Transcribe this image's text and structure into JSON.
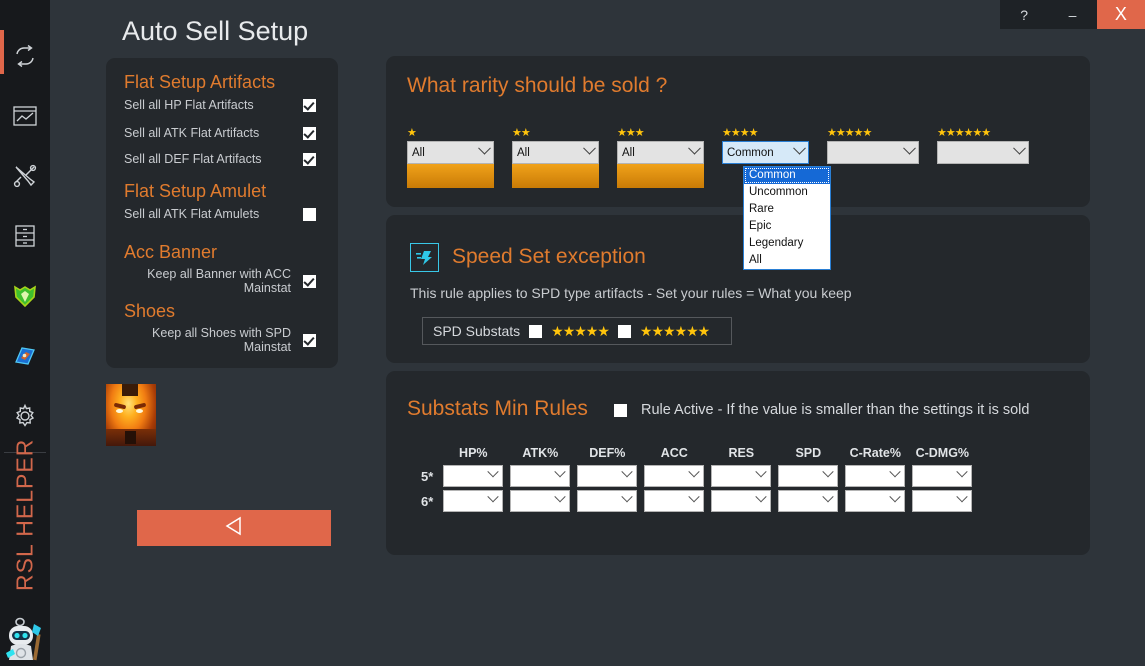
{
  "window": {
    "help_label": "?",
    "minimize_label": "–",
    "close_label": "X"
  },
  "page_title": "Auto Sell Setup",
  "sidebar": {
    "brand": "RSL HELPER",
    "items": [
      {
        "name": "sync-icon",
        "active": true
      },
      {
        "name": "chart-icon",
        "active": false
      },
      {
        "name": "tools-icon",
        "active": false
      },
      {
        "name": "storage-icon",
        "active": false
      },
      {
        "name": "shield-icon",
        "active": false
      },
      {
        "name": "gem-icon",
        "active": false
      },
      {
        "name": "gear-icon",
        "active": false
      }
    ]
  },
  "left_panel": {
    "sections": [
      {
        "title": "Flat Setup Artifacts",
        "rows": [
          {
            "label": "Sell all HP Flat Artifacts",
            "checked": true
          },
          {
            "label": "Sell all ATK Flat Artifacts",
            "checked": true
          },
          {
            "label": "Sell all DEF Flat Artifacts",
            "checked": true
          }
        ]
      },
      {
        "title": "Flat Setup Amulet",
        "rows": [
          {
            "label": "Sell all ATK Flat Amulets",
            "checked": false
          }
        ]
      },
      {
        "title": "Acc Banner",
        "rows": [
          {
            "label": "Keep all Banner with ACC Mainstat",
            "checked": true
          }
        ]
      },
      {
        "title": "Shoes",
        "rows": [
          {
            "label": "Keep all Shoes with SPD Mainstat",
            "checked": true
          }
        ]
      }
    ]
  },
  "back_button": {
    "icon": "back-triangle-icon"
  },
  "rarity_panel": {
    "title": "What rarity should be sold ?",
    "cells": [
      {
        "stars": "★",
        "value": "All",
        "gold_bar": true,
        "open": false
      },
      {
        "stars": "★★",
        "value": "All",
        "gold_bar": true,
        "open": false
      },
      {
        "stars": "★★★",
        "value": "All",
        "gold_bar": true,
        "open": false
      },
      {
        "stars": "★★★★",
        "value": "Common",
        "gold_bar": false,
        "open": true
      },
      {
        "stars": "★★★★★",
        "value": "",
        "gold_bar": false,
        "open": false
      },
      {
        "stars": "★★★★★★",
        "value": "",
        "gold_bar": false,
        "open": false
      }
    ],
    "dropdown": {
      "selected": "Common",
      "options": [
        "Common",
        "Uncommon",
        "Rare",
        "Epic",
        "Legendary",
        "All"
      ]
    }
  },
  "speed_panel": {
    "icon": "speed-boot-icon",
    "title": "Speed Set exception",
    "description": "This rule applies to SPD type artifacts - Set your rules = What you keep",
    "substats_label": "SPD Substats",
    "substat_checks": [
      {
        "stars": "★★★★★",
        "checked": false
      },
      {
        "stars": "★★★★★★",
        "checked": false
      }
    ],
    "selects": [
      {
        "stars": "★★★★★",
        "value": ""
      },
      {
        "stars": "★★★★★★",
        "value": ""
      }
    ]
  },
  "substats_panel": {
    "title": "Substats Min Rules",
    "rule_active_checked": false,
    "rule_active_text": "Rule Active - If the value is smaller than the settings it is sold",
    "columns": [
      "HP%",
      "ATK%",
      "DEF%",
      "ACC",
      "RES",
      "SPD",
      "C-Rate%",
      "C-DMG%"
    ],
    "rows": [
      {
        "label": "5*",
        "values": [
          "",
          "",
          "",
          "",
          "",
          "",
          "",
          ""
        ]
      },
      {
        "label": "6*",
        "values": [
          "",
          "",
          "",
          "",
          "",
          "",
          "",
          ""
        ]
      }
    ]
  },
  "colors": {
    "accent_orange": "#e07b2e",
    "brand_red": "#e0674a",
    "star_gold": "#ffc40c",
    "panel_bg": "#24282c",
    "app_bg": "#2e343a",
    "sidebar_bg": "#17191c",
    "cyan": "#39c8e8"
  }
}
